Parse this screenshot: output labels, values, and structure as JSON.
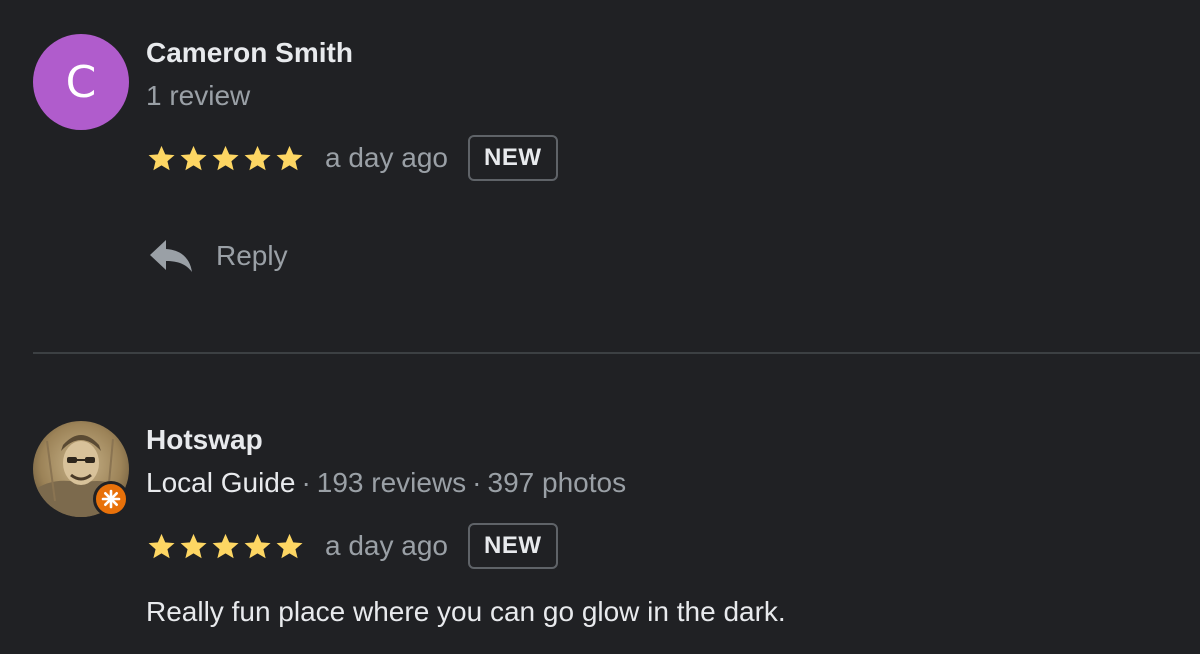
{
  "reviews": [
    {
      "avatar_letter": "C",
      "avatar_color": "#b05ccc",
      "name": "Cameron Smith",
      "review_count": "1 review",
      "rating": 5,
      "time": "a day ago",
      "badge": "NEW",
      "reply_label": "Reply"
    },
    {
      "name": "Hotswap",
      "guide_label": "Local Guide",
      "separator": "·",
      "review_count": "193 reviews",
      "photo_count": "397 photos",
      "rating": 5,
      "time": "a day ago",
      "badge": "NEW",
      "text": "Really fun place where you can go glow in the dark."
    }
  ],
  "colors": {
    "background": "#202124",
    "star": "#fdd663",
    "guide_badge": "#e8710a"
  }
}
